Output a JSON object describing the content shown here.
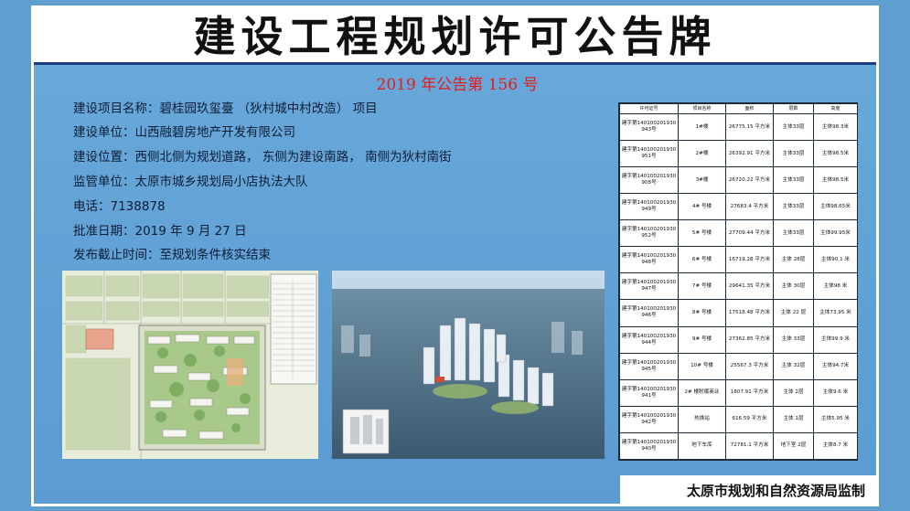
{
  "title": "建设工程规划许可公告牌",
  "notice_number": "2019 年公告第 156 号",
  "info": {
    "project": {
      "label": "建设项目名称：",
      "value": "碧桂园玖玺臺 （狄村城中村改造） 项目"
    },
    "unit": {
      "label": "建设单位：",
      "value": "山西融碧房地产开发有限公司"
    },
    "location": {
      "label": "建设位置：",
      "value": "西侧北侧为规划道路， 东侧为建设南路， 南侧为狄村南街"
    },
    "supervisor": {
      "label": "监管单位：",
      "value": "太原市城乡规划局小店执法大队"
    },
    "phone": {
      "label": "电话：",
      "value": "7138878"
    },
    "approval_date": {
      "label": "批准日期：",
      "value": "2019 年 9 月 27 日"
    },
    "deadline": {
      "label": "发布截止时间：",
      "value": "至规划条件核实结束"
    }
  },
  "table": {
    "headers": [
      "许可证号",
      "项目名称",
      "面积",
      "层数",
      "高度"
    ],
    "rows": [
      {
        "permit": "建字第140100201930943号",
        "name": "1#楼",
        "area": "26775.15 平方米",
        "floors": "主体33层",
        "height": "主体98.3米"
      },
      {
        "permit": "建字第140100201930951号",
        "name": "2#楼",
        "area": "26392.91 平方米",
        "floors": "主体33层",
        "height": "主体98.5米"
      },
      {
        "permit": "建字第140100201930908号",
        "name": "3#楼",
        "area": "26720.22 平方米",
        "floors": "主体33层",
        "height": "主体98.5米"
      },
      {
        "permit": "建字第140100201930949号",
        "name": "4# 号楼",
        "area": "27683.4 平方米",
        "floors": "主体33层",
        "height": "主体98.65米"
      },
      {
        "permit": "建字第140100201930952号",
        "name": "5# 号楼",
        "area": "27709.44 平方米",
        "floors": "主体33层",
        "height": "主体99.95米"
      },
      {
        "permit": "建字第140100201930948号",
        "name": "6# 号楼",
        "area": "16719.28 平方米",
        "floors": "主体 28层",
        "height": "主体90.1 米"
      },
      {
        "permit": "建字第140100201930947号",
        "name": "7# 号楼",
        "area": "29641.35 平方米",
        "floors": "主体 30层",
        "height": "主体98 米"
      },
      {
        "permit": "建字第140100201930946号",
        "name": "8# 号楼",
        "area": "17518.48 平方米",
        "floors": "主体 22 层",
        "height": "主体73.95 米"
      },
      {
        "permit": "建字第140100201930944号",
        "name": "9# 号楼",
        "area": "27362.85 平方米",
        "floors": "主体 33层",
        "height": "主体99.9 米"
      },
      {
        "permit": "建字第140100201930945号",
        "name": "10# 号楼",
        "area": "25567.3 平方米",
        "floors": "主体 32层",
        "height": "主体94.7米"
      },
      {
        "permit": "建字第140100201930941号",
        "name": "2# 楼附属商业",
        "area": "1807.91 平方米",
        "floors": "主体 2层",
        "height": "主体9.6 米"
      },
      {
        "permit": "建字第140100201930942号",
        "name": "热换站",
        "area": "616.59 平方米",
        "floors": "主体 1层",
        "height": "主体5.95 米"
      },
      {
        "permit": "建字第140100201930940号",
        "name": "地下车库",
        "area": "72781.1 平方米",
        "floors": "地下室 2层",
        "height": "主体8.7 米"
      }
    ]
  },
  "supervision": "太原市规划和自然资源局监制",
  "colors": {
    "background": "#5f9fd0",
    "title_bar": "#ffffff",
    "notice_red": "#e41c1c"
  }
}
